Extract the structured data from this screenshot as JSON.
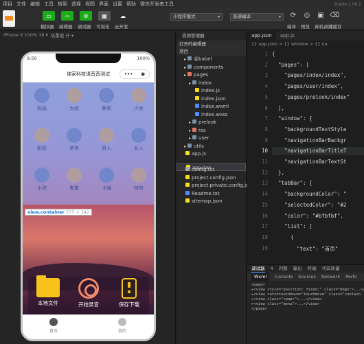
{
  "menu": [
    "项目",
    "文件",
    "编辑",
    "工具",
    "转到",
    "选择",
    "视图",
    "界面",
    "设置",
    "帮助",
    "微信开发者工具"
  ],
  "window_title": "微信开发者工具",
  "version": "Stable 1.06.2",
  "toolbar": {
    "left_buttons": [
      {
        "label": "模拟器",
        "color": "#1aad19",
        "glyph": "▭"
      },
      {
        "label": "编辑器",
        "color": "#1aad19",
        "glyph": "‹›"
      },
      {
        "label": "调试器",
        "color": "#1aad19",
        "glyph": "⚙"
      },
      {
        "label": "可视化",
        "color": "#555",
        "glyph": "▦"
      },
      {
        "label": "云开发",
        "color": "#2d2d2d",
        "glyph": "☁"
      }
    ],
    "mode_select": "小程序模式",
    "compile_select": "普通编译",
    "right_buttons": [
      "编译",
      "预览",
      "真机调试",
      "清缓存"
    ]
  },
  "simulator": {
    "device": "iPhone X 100% 16 ▾",
    "hotreload": "热重载 开 ▾",
    "status": {
      "time": "9:50",
      "battery": "100%"
    },
    "nav_title": "佳家科技语音音测试",
    "grid_labels": [
      [
        "妈妈",
        "大叔",
        "萝莉",
        "少女"
      ],
      [
        "奶奶",
        "爸爸",
        "男人",
        "女人"
      ],
      [
        "小孩",
        "鬼畜",
        "卡通",
        "特效"
      ]
    ],
    "actions": [
      {
        "label": "本地文件",
        "icon": "folder-icon"
      },
      {
        "label": "开始录音",
        "icon": "record-icon"
      },
      {
        "label": "保存下载",
        "icon": "download-icon"
      }
    ],
    "tabs": [
      {
        "label": "首页",
        "active": true
      },
      {
        "label": "我的",
        "active": false
      }
    ],
    "tooltip": {
      "tag": "view.container",
      "size": "375 × 342"
    }
  },
  "explorer": {
    "header": "资源管理器",
    "sections": [
      "打开的编辑器",
      "项目"
    ],
    "tree": [
      {
        "label": "@babel",
        "depth": 1,
        "type": "folder",
        "color": "#7a8fa8"
      },
      {
        "label": "components",
        "depth": 1,
        "type": "folder",
        "color": "#7a8fa8"
      },
      {
        "label": "pages",
        "depth": 1,
        "type": "folder",
        "color": "#e07a5f"
      },
      {
        "label": "index",
        "depth": 2,
        "type": "folder",
        "color": "#7a8fa8"
      },
      {
        "label": "index.js",
        "depth": 3,
        "type": "file",
        "color": "#f5de19"
      },
      {
        "label": "index.json",
        "depth": 3,
        "type": "file",
        "color": "#f5de19"
      },
      {
        "label": "index.wxml",
        "depth": 3,
        "type": "file",
        "color": "#4c8dff"
      },
      {
        "label": "index.wxss",
        "depth": 3,
        "type": "file",
        "color": "#4c8dff"
      },
      {
        "label": "prelook",
        "depth": 2,
        "type": "folder",
        "color": "#7a8fa8"
      },
      {
        "label": "res",
        "depth": 2,
        "type": "folder",
        "color": "#e07a5f"
      },
      {
        "label": "user",
        "depth": 2,
        "type": "folder",
        "color": "#7a8fa8"
      },
      {
        "label": "utils",
        "depth": 1,
        "type": "folder",
        "color": "#7a8fa8"
      },
      {
        "label": "app.js",
        "depth": 1,
        "type": "file",
        "color": "#f5de19"
      },
      {
        "label": "app.json",
        "depth": 1,
        "type": "file",
        "color": "#f5de19",
        "selected": true
      },
      {
        "label": "config.txt",
        "depth": 1,
        "type": "file",
        "color": "#aaa"
      },
      {
        "label": "project.config.json",
        "depth": 1,
        "type": "file",
        "color": "#f5de19"
      },
      {
        "label": "project.private.config.js...",
        "depth": 1,
        "type": "file",
        "color": "#f5de19"
      },
      {
        "label": "Readme.txt",
        "depth": 1,
        "type": "file",
        "color": "#4c8dff"
      },
      {
        "label": "sitemap.json",
        "depth": 1,
        "type": "file",
        "color": "#f5de19"
      }
    ]
  },
  "editor": {
    "tabs": [
      {
        "label": "app.json",
        "active": true
      },
      {
        "label": "app.js",
        "active": false
      }
    ],
    "breadcrumb": "{} app.json > {} window > {} na",
    "current_line": 10,
    "lines": [
      {
        "n": 1,
        "t": "{"
      },
      {
        "n": 2,
        "t": "  \"pages\": ["
      },
      {
        "n": 3,
        "t": "    \"pages/index/index\","
      },
      {
        "n": 4,
        "t": "    \"pages/user/index\","
      },
      {
        "n": 5,
        "t": "    \"pages/prelook/index\""
      },
      {
        "n": 6,
        "t": "  ],"
      },
      {
        "n": 7,
        "t": "  \"window\": {"
      },
      {
        "n": 8,
        "t": "    \"backgroundTextStyle"
      },
      {
        "n": 9,
        "t": "    \"navigationBarBackgr"
      },
      {
        "n": 10,
        "t": "    \"navigationBarTitleT"
      },
      {
        "n": 11,
        "t": "    \"navigationBarTextSt"
      },
      {
        "n": 12,
        "t": "  },"
      },
      {
        "n": 13,
        "t": "  \"tabBar\": {"
      },
      {
        "n": 14,
        "t": "    \"backgroundColor\": \""
      },
      {
        "n": 15,
        "t": "    \"selectedColor\": \"#2"
      },
      {
        "n": 16,
        "t": "    \"color\": \"#bfbfbf\","
      },
      {
        "n": 17,
        "t": "    \"list\": ["
      },
      {
        "n": 18,
        "t": "      {"
      },
      {
        "n": 19,
        "t": "        \"text\": \"首页\""
      }
    ]
  },
  "devtools": {
    "tabs": [
      "调试器",
      "4",
      "问题",
      "输出",
      "终端",
      "代码质量"
    ],
    "subtabs": [
      "Wxml",
      "Console",
      "Sources",
      "Network",
      "Perfo"
    ],
    "dom": [
      "<page>",
      "▸<view style=\"position: fixed;\" class=\"mbgs\">...</view>",
      "▸<view catchtouchmove=\"touchmove\" class=\"contain",
      "▸<view class=\"cpapr\">...</view>",
      "▸<view class=\"menu\">...</view>",
      "</page>"
    ]
  }
}
